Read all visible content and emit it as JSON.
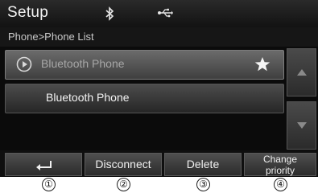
{
  "header": {
    "title": "Setup",
    "icons": {
      "bluetooth": "bluetooth-icon",
      "usb": "usb-icon"
    }
  },
  "breadcrumb": "Phone>Phone List",
  "list": {
    "items": [
      {
        "label": "Bluetooth Phone",
        "selected": true,
        "icons": [
          "play-circle-icon",
          "star-icon"
        ]
      },
      {
        "label": "Bluetooth Phone",
        "selected": false
      }
    ]
  },
  "scroll": {
    "up_icon": "triangle-up-icon",
    "down_icon": "triangle-down-icon"
  },
  "bottom": {
    "back_icon": "back-arrow-icon",
    "disconnect_label": "Disconnect",
    "delete_label": "Delete",
    "priority_label_line1": "Change",
    "priority_label_line2": "priority"
  },
  "callouts": [
    "①",
    "②",
    "③",
    "④"
  ],
  "colors": {
    "background": "#0b0b0b",
    "text": "#f0f0f0",
    "dim_text": "#a7a7a7"
  }
}
